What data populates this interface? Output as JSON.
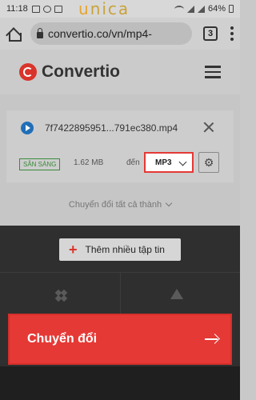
{
  "status_bar": {
    "time": "11:18",
    "battery": "64%"
  },
  "watermark": {
    "text_u": "u",
    "text_rest": "nica"
  },
  "browser": {
    "url": "convertio.co/vn/mp4-",
    "tab_count": "3"
  },
  "site": {
    "brand": "Convertio"
  },
  "file": {
    "name": "7f7422895951...791ec380.mp4",
    "status": "SẴN SÀNG",
    "size": "1.62 MB",
    "to_label": "đến",
    "format": "MP3"
  },
  "convert_all": "Chuyển đổi tất cả thành",
  "upload": {
    "add_more_label": "Thêm nhiều tập tin"
  },
  "convert_button": {
    "label": "Chuyển đổi"
  },
  "colors": {
    "accent": "#e53935",
    "dark": "#2f2f2f"
  }
}
